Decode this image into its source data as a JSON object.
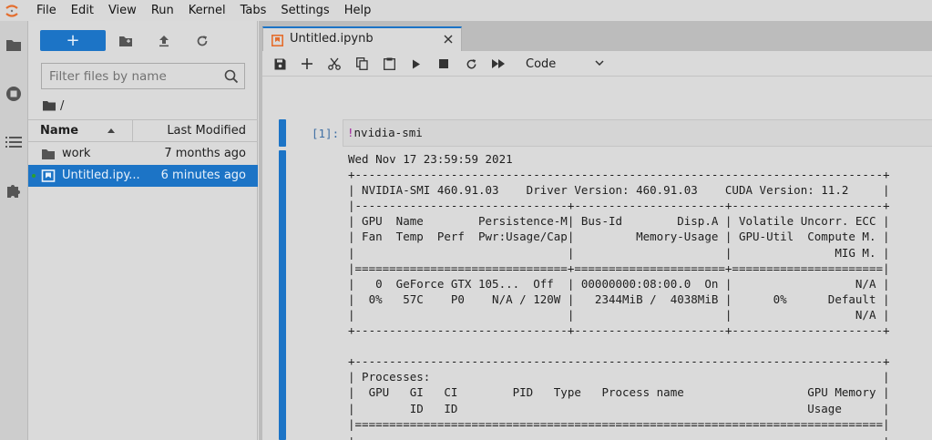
{
  "menu": [
    "File",
    "Edit",
    "View",
    "Run",
    "Kernel",
    "Tabs",
    "Settings",
    "Help"
  ],
  "colors": {
    "accent": "#1c74c6",
    "logo_orange": "#e46e2e",
    "running_green": "#2ca02c",
    "magic_purple": "#a0239c"
  },
  "activity_bar": {
    "icons": [
      "folder-icon",
      "stop-circle-icon",
      "list-icon",
      "puzzle-icon"
    ]
  },
  "file_browser": {
    "new_label": "+",
    "filter_placeholder": "Filter files by name",
    "breadcrumb": "/",
    "columns": {
      "name": "Name",
      "modified": "Last Modified"
    },
    "files": [
      {
        "name": "work",
        "modified": "7 months ago",
        "type": "folder",
        "selected": false,
        "running": false
      },
      {
        "name": "Untitled.ipy...",
        "modified": "6 minutes ago",
        "type": "notebook",
        "selected": true,
        "running": true
      }
    ]
  },
  "tab": {
    "label": "Untitled.ipynb"
  },
  "notebook_toolbar": {
    "cell_type": "Code"
  },
  "cell": {
    "prompt": "[1]:",
    "code_magic": "!",
    "code_rest": "nvidia-smi",
    "output": "Wed Nov 17 23:59:59 2021\n+-----------------------------------------------------------------------------+\n| NVIDIA-SMI 460.91.03    Driver Version: 460.91.03    CUDA Version: 11.2     |\n|-------------------------------+----------------------+----------------------+\n| GPU  Name        Persistence-M| Bus-Id        Disp.A | Volatile Uncorr. ECC |\n| Fan  Temp  Perf  Pwr:Usage/Cap|         Memory-Usage | GPU-Util  Compute M. |\n|                               |                      |               MIG M. |\n|===============================+======================+======================|\n|   0  GeForce GTX 105...  Off  | 00000000:08:00.0  On |                  N/A |\n|  0%   57C    P0    N/A / 120W |   2344MiB /  4038MiB |      0%      Default |\n|                               |                      |                  N/A |\n+-------------------------------+----------------------+----------------------+\n\n+-----------------------------------------------------------------------------+\n| Processes:                                                                  |\n|  GPU   GI   CI        PID   Type   Process name                  GPU Memory |\n|        ID   ID                                                   Usage      |\n|=============================================================================|\n+-----------------------------------------------------------------------------+"
  }
}
